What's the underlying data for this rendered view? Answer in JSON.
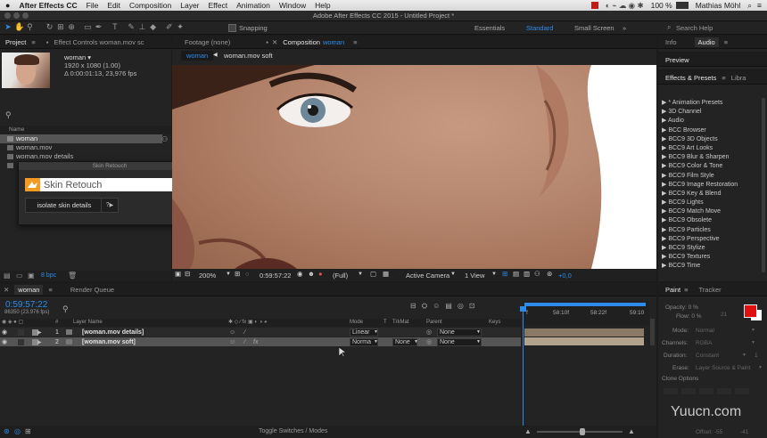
{
  "menubar": {
    "app": "After Effects CC",
    "items": [
      "File",
      "Edit",
      "Composition",
      "Layer",
      "Effect",
      "Animation",
      "Window",
      "Help"
    ],
    "battery": "100 %",
    "user": "Mathias Möhl"
  },
  "window_title": "Adobe After Effects CC 2015 - Untitled Project *",
  "toolbar": {
    "snapping": "Snapping",
    "workspaces": [
      "Essentials",
      "Standard",
      "Small Screen"
    ],
    "search_placeholder": "Search Help"
  },
  "project": {
    "tabs": [
      "Project",
      "Effect Controls woman.mov sc"
    ],
    "preview_name": "woman ▾",
    "preview_info": [
      "1920 x 1080 (1.00)",
      "Δ 0:00:01:13, 23,976 fps"
    ],
    "search_icon": "search-icon",
    "col_name": "Name",
    "items": [
      "woman",
      "woman.mov",
      "woman.mov details"
    ],
    "bpc": "8 bpc"
  },
  "skin_retouch": {
    "title": "Skin Retouch",
    "brand": "Skin Retouch",
    "isolate_button": "isolate skin details",
    "help_button": "?",
    "play": "▶"
  },
  "viewer": {
    "tabs": [
      "Footage (none)",
      "Composition"
    ],
    "comp_name": "woman",
    "breadcrumbs": [
      "woman",
      "woman.mov soft"
    ],
    "zoom": "200%",
    "timecode": "0:59:57:22",
    "resolution": "(Full)",
    "camera": "Active Camera",
    "views": "1 View",
    "exposure": "+0,0"
  },
  "right_panels": {
    "top_tabs": [
      "Info",
      "Audio"
    ],
    "preview_tab": "Preview",
    "fx_tabs": [
      "Effects & Presets",
      "Libra"
    ],
    "effects": [
      "* Animation Presets",
      "3D Channel",
      "Audio",
      "BCC Browser",
      "BCC9 3D Objects",
      "BCC9 Art Looks",
      "BCC9 Blur & Sharpen",
      "BCC9 Color & Tone",
      "BCC9 Film Style",
      "BCC9 Image Restoration",
      "BCC9 Key & Blend",
      "BCC9 Lights",
      "BCC9 Match Move",
      "BCC9 Obsolete",
      "BCC9 Particles",
      "BCC9 Perspective",
      "BCC9 Stylize",
      "BCC9 Textures",
      "BCC9 Time"
    ]
  },
  "paint": {
    "tabs": [
      "Paint",
      "Tracker"
    ],
    "opacity": "Opacity: 0 %",
    "flow": "Flow: 0 %",
    "brush_size": "21",
    "mode_label": "Mode:",
    "mode_value": "Normal",
    "channels_label": "Channels:",
    "channels_value": "RGBA",
    "duration_label": "Duration:",
    "duration_value": "Constant",
    "duration_num": "1",
    "erase_label": "Erase:",
    "erase_value": "Layer Source & Paint",
    "clone_options": "Clone Options",
    "offset": "Offset: -55",
    "offset2": "-41"
  },
  "timeline": {
    "tabs": [
      "woman",
      "Render Queue"
    ],
    "timecode": "0:59:57:22",
    "frames": "86350 (23.976 fps)",
    "col_headers": {
      "layer_name": "Layer Name",
      "mode": "Mode",
      "t": "T",
      "trkmat": "TrkMat",
      "parent": "Parent",
      "keys": "Keys"
    },
    "ruler_labels": [
      "58:10f",
      "58:22f",
      "59:10"
    ],
    "ruler_start": "f",
    "layers": [
      {
        "num": "1",
        "name": "[woman.mov details]",
        "mode": "Linear",
        "trkmat": "",
        "parent": "None"
      },
      {
        "num": "2",
        "name": "[woman.mov soft]",
        "mode": "Norma",
        "trkmat": "None",
        "parent": "None"
      }
    ],
    "footer": "Toggle Switches / Modes"
  },
  "watermark": "Yuucn.com",
  "colors": {
    "accent": "#2d8ceb",
    "brand_orange": "#f39a22",
    "paint_red": "#e01010",
    "work_area": "#8a7a65",
    "layer_bar": "#b3a38d"
  }
}
